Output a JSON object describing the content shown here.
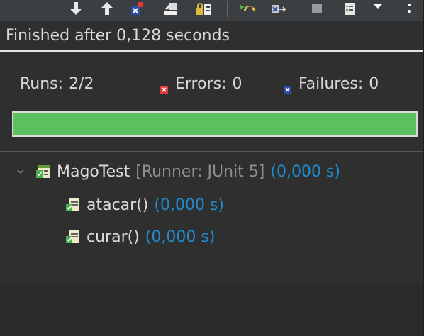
{
  "status": {
    "text": "Finished after 0,128 seconds"
  },
  "counters": {
    "runs_label": "Runs:",
    "runs_value": "2/2",
    "errors_label": "Errors:",
    "errors_value": "0",
    "failures_label": "Failures:",
    "failures_value": "0"
  },
  "progress": {
    "fraction": 1.0,
    "color": "#5cc05e"
  },
  "tree": {
    "root": {
      "name": "MagoTest",
      "runner": "[Runner: JUnit 5]",
      "time": "(0,000 s)"
    },
    "children": [
      {
        "name": "atacar()",
        "time": "(0,000 s)"
      },
      {
        "name": "curar()",
        "time": "(0,000 s)"
      }
    ]
  },
  "toolbar": {
    "icons": [
      "next-failure-icon",
      "previous-failure-icon",
      "show-failures-only-icon",
      "scroll-lock-icon",
      "show-skipped-icon",
      "rerun-test-icon",
      "rerun-failed-first-icon",
      "stop-icon",
      "test-run-history-icon",
      "view-menu-icon",
      "more-options-icon"
    ]
  },
  "colors": {
    "background": "#2f2f2f",
    "text": "#d8d8d8",
    "time": "#1f8ccf",
    "runner": "#8e8e8e",
    "error_badge": "#e03b3b",
    "failure_badge": "#2e4ea8"
  }
}
